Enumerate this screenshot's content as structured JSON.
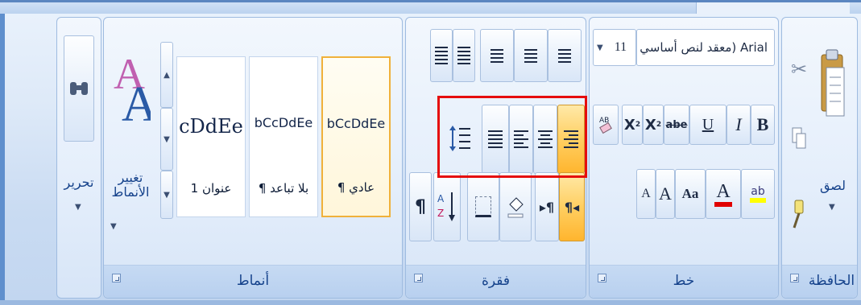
{
  "groups": {
    "clipboard": {
      "label": "الحافظة",
      "paste": "لصق"
    },
    "font": {
      "label": "خط",
      "font_name": "معقد لنص أساسي) Arial",
      "font_size": "11",
      "bold": "B",
      "italic": "I",
      "underline": "U",
      "strike": "abe",
      "subscript": "X",
      "superscript": "X",
      "change_case": "Aa",
      "font_color": "A",
      "grow": "A",
      "shrink": "A"
    },
    "paragraph": {
      "label": "فقرة",
      "pilcrow": "¶"
    },
    "styles": {
      "label": "أنماط",
      "tiles": [
        {
          "sample": "bCcDdEe",
          "name": "¶ عادي",
          "selected": true
        },
        {
          "sample": "bCcDdEe",
          "name": "¶ بلا تباعد",
          "selected": false
        },
        {
          "sample": "cDdEe",
          "name": "عنوان 1",
          "selected": false
        }
      ],
      "change_styles": "تغيير الأنماط"
    },
    "editing": {
      "label": "تحرير"
    }
  },
  "colors": {
    "accent": "#15428b",
    "highlight_box": "#e50d0d",
    "active": "#ffcf62"
  }
}
